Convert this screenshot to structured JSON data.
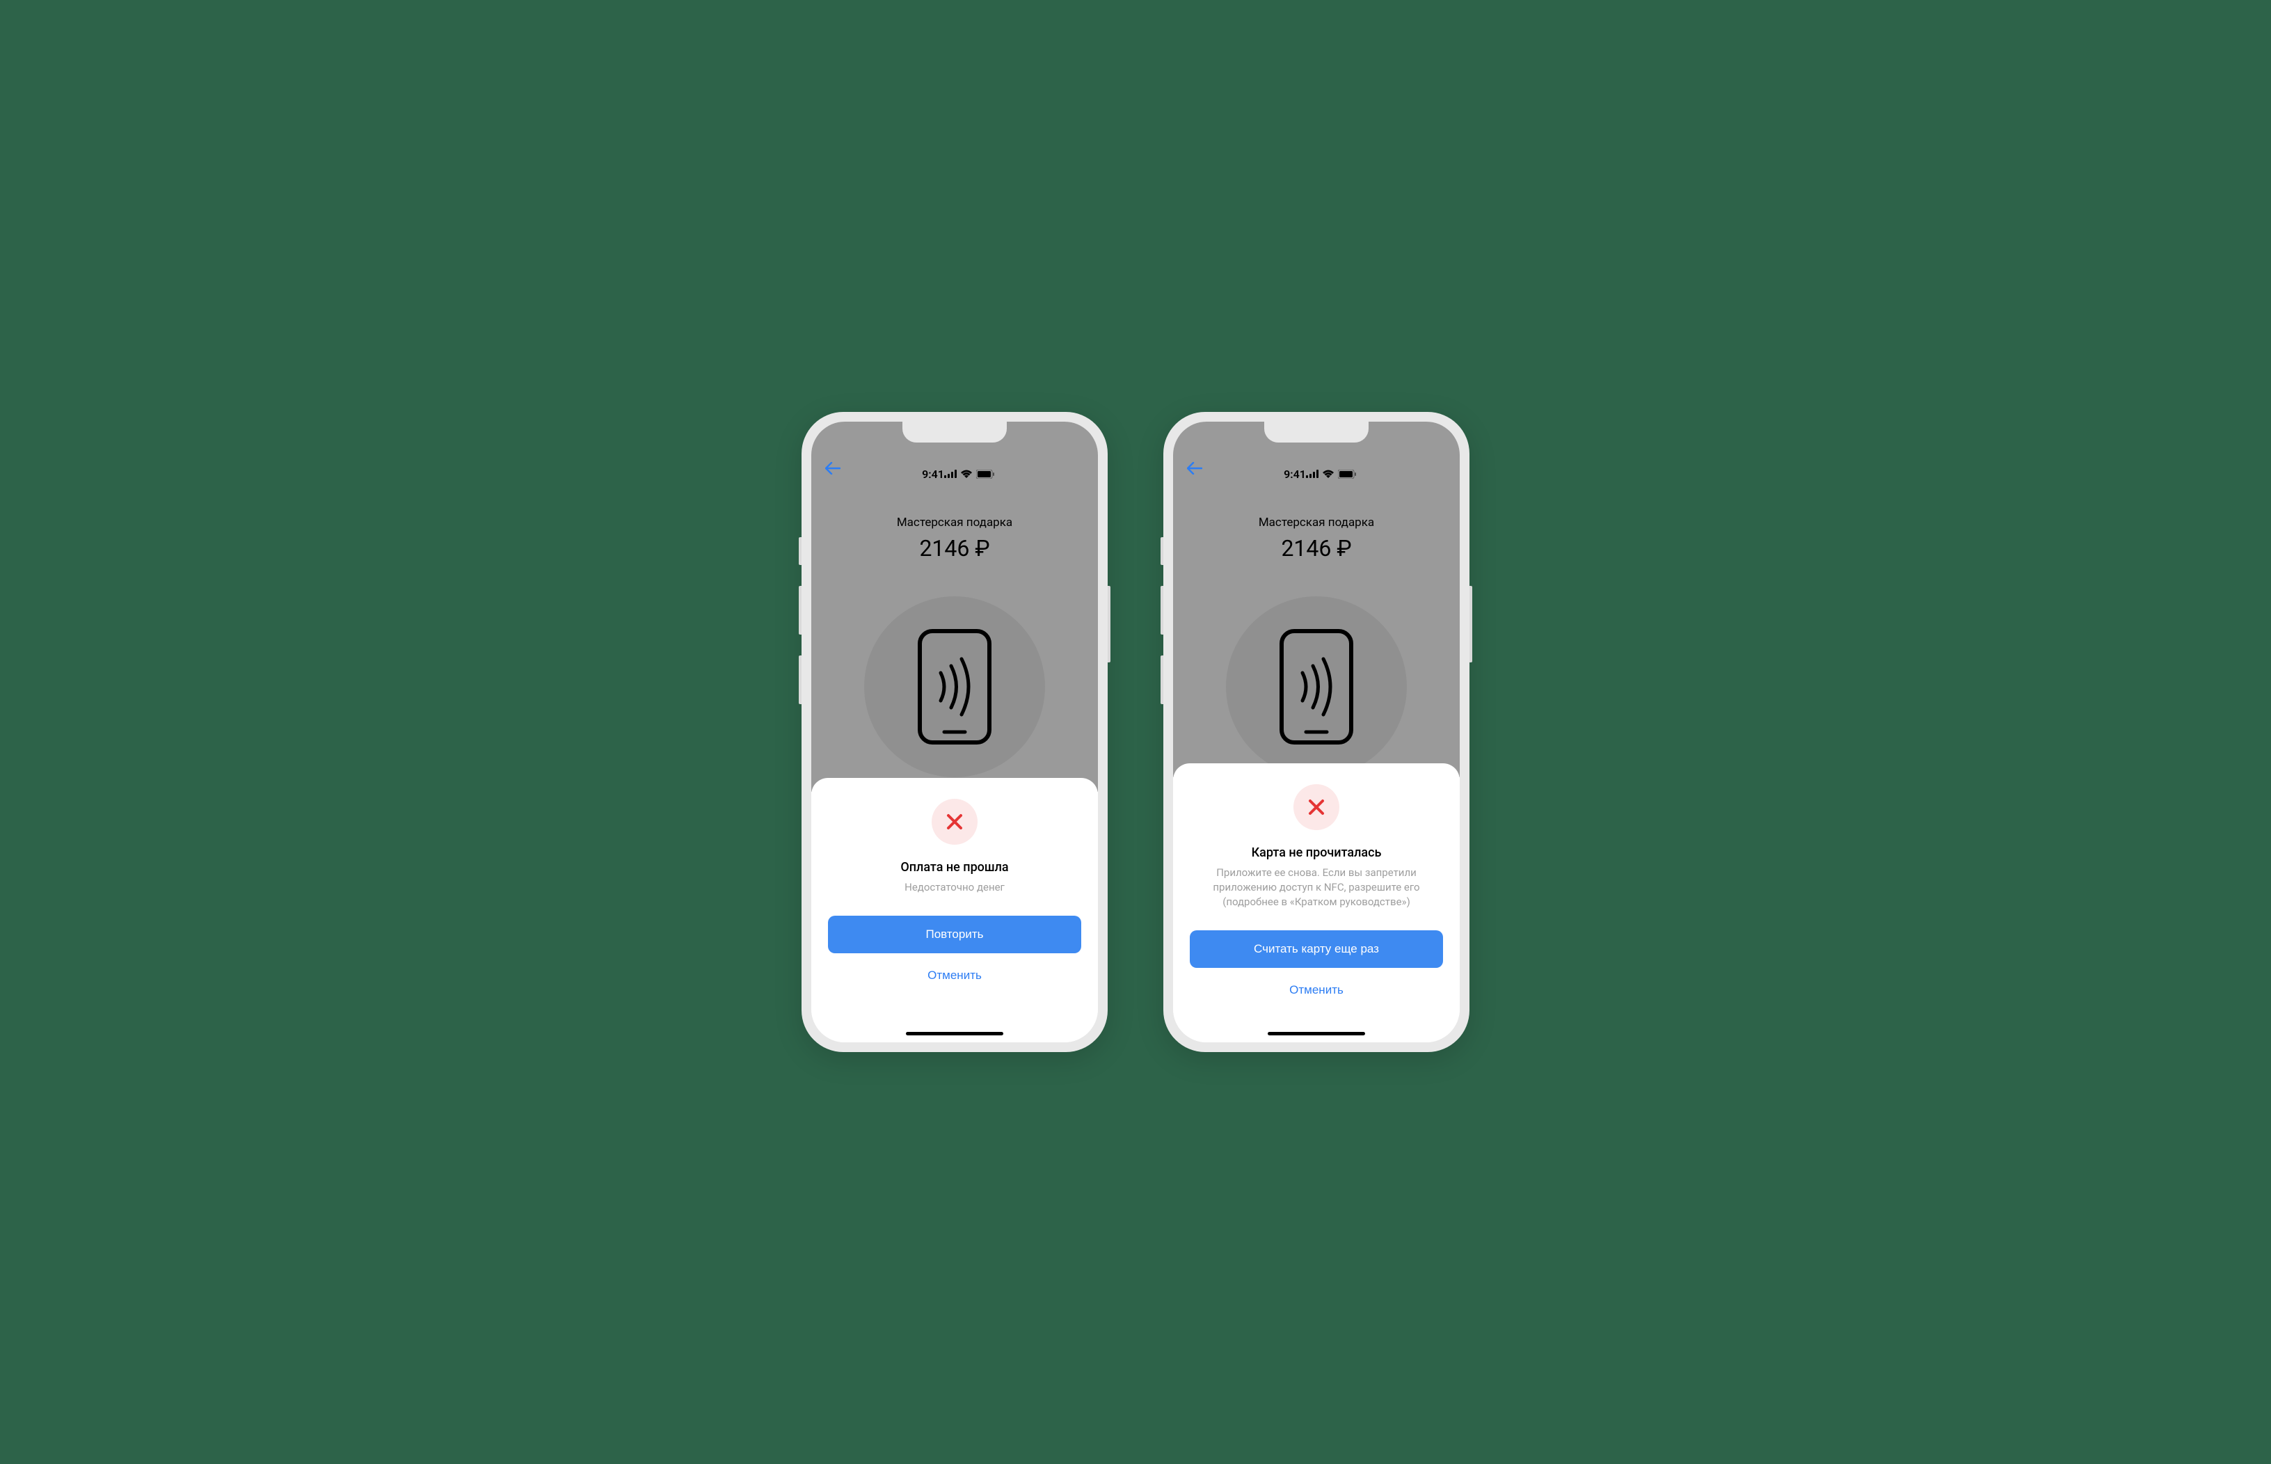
{
  "status": {
    "time": "9:41"
  },
  "merchant": "Мастерская подарка",
  "amount": "2146 ₽",
  "screens": [
    {
      "error_title": "Оплата не прошла",
      "error_subtitle": "Недостаточно денег",
      "primary_button": "Повторить",
      "secondary_button": "Отменить"
    },
    {
      "error_title": "Карта не прочиталась",
      "error_subtitle": "Приложите ее снова. Если вы запретили приложению доступ к NFC, разрешите его (подробнее в «Кратком руководстве»)",
      "primary_button": "Считать карту еще раз",
      "secondary_button": "Отменить"
    }
  ]
}
